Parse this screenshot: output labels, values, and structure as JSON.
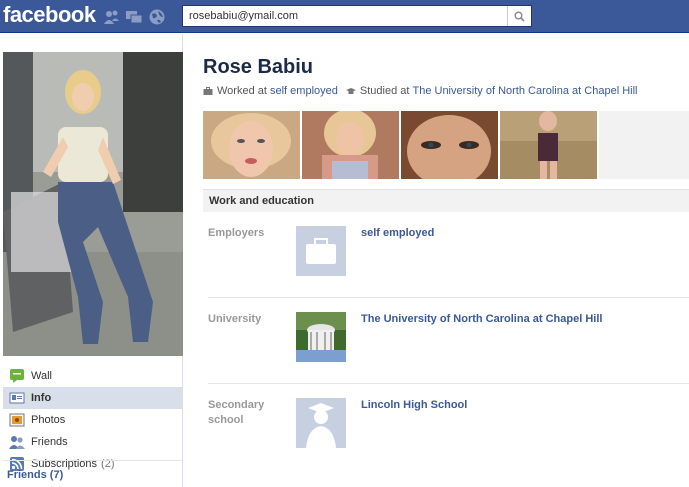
{
  "header": {
    "logo": "facebook",
    "search_value": "rosebabiu@ymail.com"
  },
  "left_nav": {
    "items": [
      {
        "label": "Wall",
        "icon": "wall-icon"
      },
      {
        "label": "Info",
        "icon": "info-icon",
        "active": true
      },
      {
        "label": "Photos",
        "icon": "photos-icon"
      },
      {
        "label": "Friends",
        "icon": "friends-icon"
      },
      {
        "label": "Subscriptions",
        "icon": "subscriptions-icon",
        "count": "(2)"
      }
    ],
    "friends_label": "Friends (7)"
  },
  "profile": {
    "name": "Rose Babiu",
    "worked_prefix": "Worked at",
    "worked_link": "self employed",
    "studied_prefix": "Studied at",
    "studied_link": "The University of North Carolina at Chapel Hill"
  },
  "section": {
    "title": "Work and education",
    "rows": [
      {
        "label": "Employers",
        "value": "self employed"
      },
      {
        "label": "University",
        "value": "The University of North Carolina at Chapel Hill"
      },
      {
        "label": "Secondary school",
        "value": "Lincoln High School"
      }
    ]
  },
  "colors": {
    "brand": "#3b5998",
    "link": "#3b5998",
    "nav_active": "#d8dfea"
  }
}
